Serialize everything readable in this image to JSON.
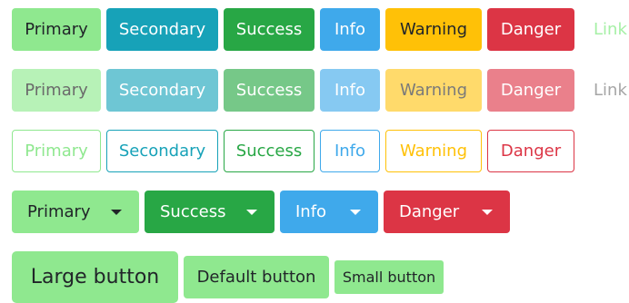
{
  "colors": {
    "primary": "#8fe88f",
    "secondary": "#17a2b8",
    "success": "#28a745",
    "info": "#3fa9eb",
    "warning": "#ffc107",
    "danger": "#dc3545",
    "link": "#a6f0a6"
  },
  "rows": {
    "solid": [
      {
        "label": "Primary"
      },
      {
        "label": "Secondary"
      },
      {
        "label": "Success"
      },
      {
        "label": "Info"
      },
      {
        "label": "Warning"
      },
      {
        "label": "Danger"
      },
      {
        "label": "Link"
      }
    ],
    "disabled": [
      {
        "label": "Primary"
      },
      {
        "label": "Secondary"
      },
      {
        "label": "Success"
      },
      {
        "label": "Info"
      },
      {
        "label": "Warning"
      },
      {
        "label": "Danger"
      },
      {
        "label": "Link"
      }
    ],
    "outline": [
      {
        "label": "Primary"
      },
      {
        "label": "Secondary"
      },
      {
        "label": "Success"
      },
      {
        "label": "Info"
      },
      {
        "label": "Warning"
      },
      {
        "label": "Danger"
      }
    ],
    "dropdowns": [
      {
        "label": "Primary"
      },
      {
        "label": "Success"
      },
      {
        "label": "Info"
      },
      {
        "label": "Danger"
      }
    ],
    "sizes": {
      "large": "Large button",
      "default": "Default button",
      "small": "Small button"
    }
  }
}
